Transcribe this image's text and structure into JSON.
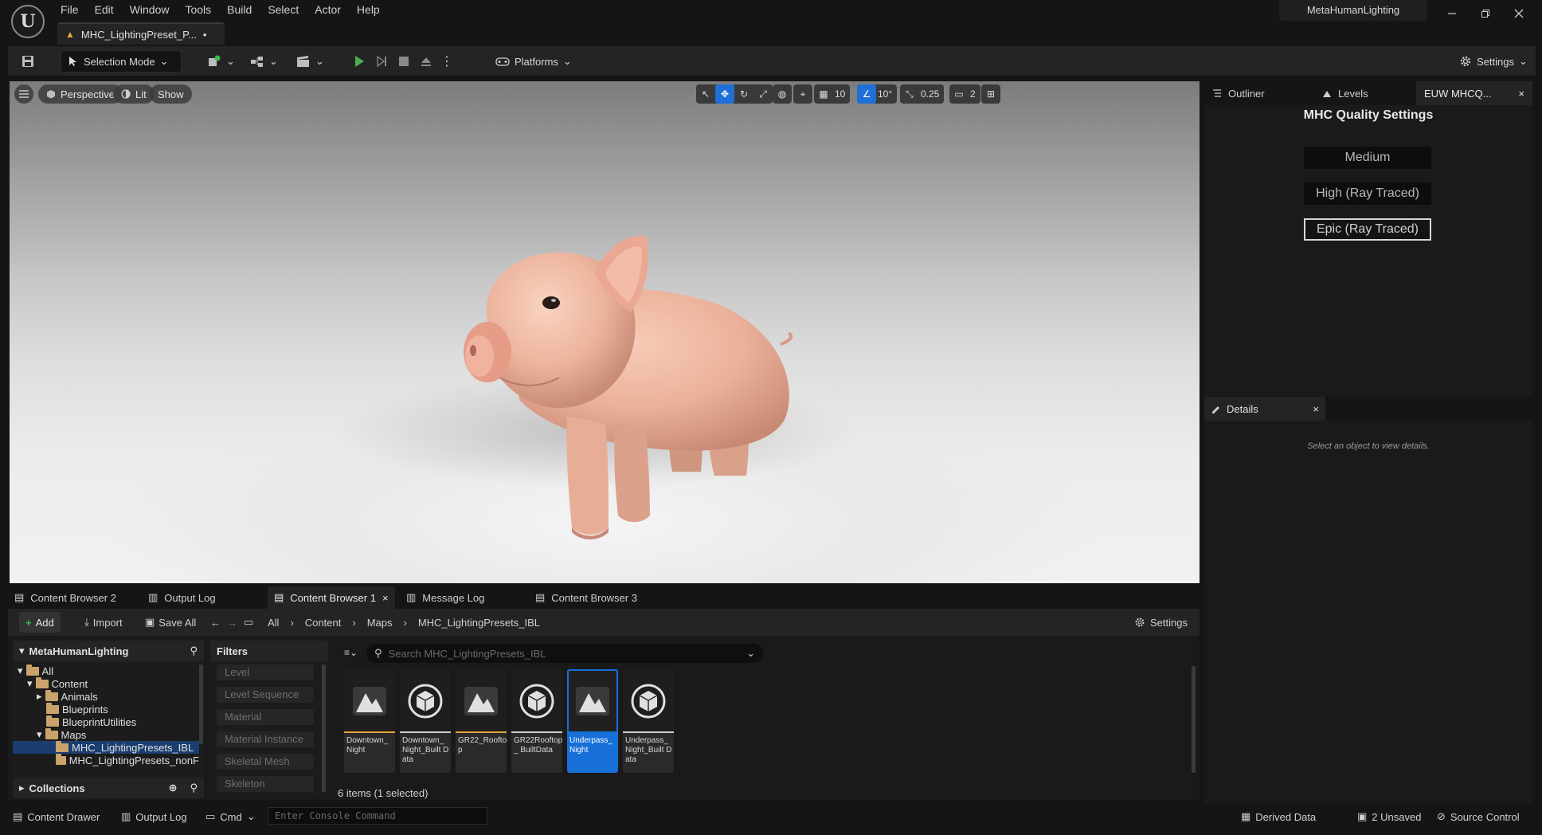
{
  "menu": [
    "File",
    "Edit",
    "Window",
    "Tools",
    "Build",
    "Select",
    "Actor",
    "Help"
  ],
  "project_name": "MetaHumanLighting",
  "document_tab": {
    "label": "MHC_LightingPreset_P...",
    "modified_mark": "•"
  },
  "toolbar": {
    "selection_mode": "Selection Mode",
    "platforms": "Platforms",
    "settings": "Settings"
  },
  "viewport": {
    "perspective": "Perspective",
    "lit": "Lit",
    "show": "Show",
    "grid_snap": "10",
    "rotation_snap": "10°",
    "scale_snap": "0.25",
    "camera_speed": "2"
  },
  "right_tabs": {
    "outliner": "Outliner",
    "levels": "Levels",
    "euw": "EUW MHCQ..."
  },
  "mhc_panel": {
    "title": "MHC Quality Settings",
    "buttons": [
      "Medium",
      "High (Ray Traced)",
      "Epic (Ray Traced)"
    ]
  },
  "details": {
    "tab": "Details",
    "empty_text": "Select an object to view details."
  },
  "cb_tabs": [
    "Content Browser 2",
    "Output Log",
    "Content Browser 1",
    "Message Log",
    "Content Browser 3"
  ],
  "cb_toolbar": {
    "add": "Add",
    "import": "Import",
    "save_all": "Save All",
    "breadcrumb": [
      "All",
      "Content",
      "Maps",
      "MHC_LightingPresets_IBL"
    ],
    "settings": "Settings"
  },
  "tree": {
    "title": "MetaHumanLighting",
    "items": [
      "All",
      "Content",
      "Animals",
      "Blueprints",
      "BlueprintUtilities",
      "Maps",
      "MHC_LightingPresets_IBL",
      "MHC_LightingPresets_nonF"
    ],
    "collections": "Collections"
  },
  "filters": {
    "title": "Filters",
    "items": [
      "Level",
      "Level Sequence",
      "Material",
      "Material Instance",
      "Skeletal Mesh",
      "Skeleton"
    ]
  },
  "assets": {
    "search_placeholder": "Search MHC_LightingPresets_IBL",
    "items": [
      {
        "name": "Downtown_ Night"
      },
      {
        "name": "Downtown_ Night_Built Data"
      },
      {
        "name": "GR22_Rooftop"
      },
      {
        "name": "GR22Rooftop_ BuiltData"
      },
      {
        "name": "Underpass_ Night"
      },
      {
        "name": "Underpass_ Night_Built Data"
      }
    ],
    "count": "6 items (1 selected)"
  },
  "status": {
    "content_drawer": "Content Drawer",
    "output_log": "Output Log",
    "cmd": "Cmd",
    "console_placeholder": "Enter Console Command",
    "derived_data": "Derived Data",
    "unsaved": "2 Unsaved",
    "source_control": "Source Control"
  },
  "colors": {
    "accent_blue": "#1670d8",
    "play_green": "#4caf50",
    "map_underline": "#e8a23a",
    "data_underline": "#cfcfcf"
  }
}
